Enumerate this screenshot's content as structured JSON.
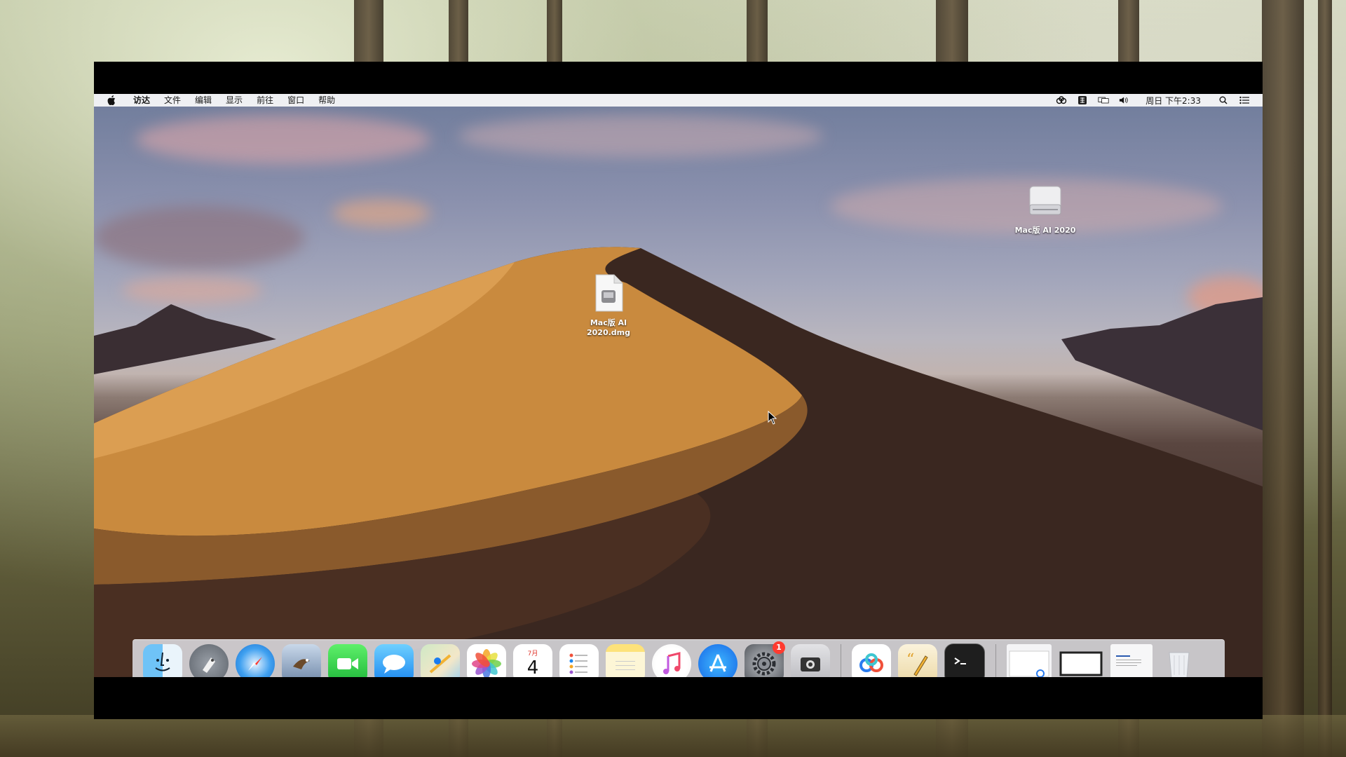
{
  "menubar": {
    "apple_icon": "apple-icon",
    "items": [
      "访达",
      "文件",
      "编辑",
      "显示",
      "前往",
      "窗口",
      "帮助"
    ],
    "clock": "周日 下午2:33",
    "status_icons": [
      "baidu-netdisk-icon",
      "input-method-icon",
      "display-mirror-icon",
      "volume-icon",
      "search-icon",
      "notification-list-icon"
    ]
  },
  "desktop_icons": {
    "drive": {
      "label": "Mac版 AI 2020",
      "icon": "external-drive-icon"
    },
    "dmg": {
      "label_line1": "Mac版 AI",
      "label_line2": "2020.dmg",
      "icon": "dmg-file-icon"
    }
  },
  "dock": {
    "apps": [
      {
        "name": "finder",
        "icon": "finder-icon"
      },
      {
        "name": "launchpad",
        "icon": "launchpad-icon"
      },
      {
        "name": "safari",
        "icon": "safari-icon"
      },
      {
        "name": "preview",
        "icon": "eagle-preview-icon"
      },
      {
        "name": "facetime",
        "icon": "facetime-icon"
      },
      {
        "name": "messages",
        "icon": "messages-icon"
      },
      {
        "name": "maps",
        "icon": "maps-icon"
      },
      {
        "name": "photos",
        "icon": "photos-icon"
      },
      {
        "name": "calendar",
        "icon": "calendar-icon",
        "month": "7月",
        "day": "4"
      },
      {
        "name": "reminders",
        "icon": "reminders-icon"
      },
      {
        "name": "notes",
        "icon": "notes-icon"
      },
      {
        "name": "music",
        "icon": "music-icon"
      },
      {
        "name": "app-store",
        "icon": "app-store-icon"
      },
      {
        "name": "system-preferences",
        "icon": "gear-icon",
        "badge": "1"
      },
      {
        "name": "screenshot",
        "icon": "screenshot-icon"
      }
    ],
    "running": [
      {
        "name": "baidu-netdisk",
        "icon": "baidu-netdisk-icon"
      },
      {
        "name": "pages-script",
        "icon": "quote-pen-icon"
      },
      {
        "name": "terminal",
        "icon": "terminal-icon"
      }
    ],
    "stacks": [
      {
        "name": "window-thumb-1",
        "icon": "window-thumbnail-icon"
      },
      {
        "name": "window-thumb-2",
        "icon": "window-thumbnail-icon"
      },
      {
        "name": "document-thumb",
        "icon": "document-thumbnail-icon"
      },
      {
        "name": "trash",
        "icon": "trash-icon"
      }
    ]
  },
  "colors": {
    "sky_top": "#6f7c9b",
    "dune_light": "#d99a4a",
    "dune_shadow": "#2c1d18",
    "badge_red": "#ff3b30"
  }
}
